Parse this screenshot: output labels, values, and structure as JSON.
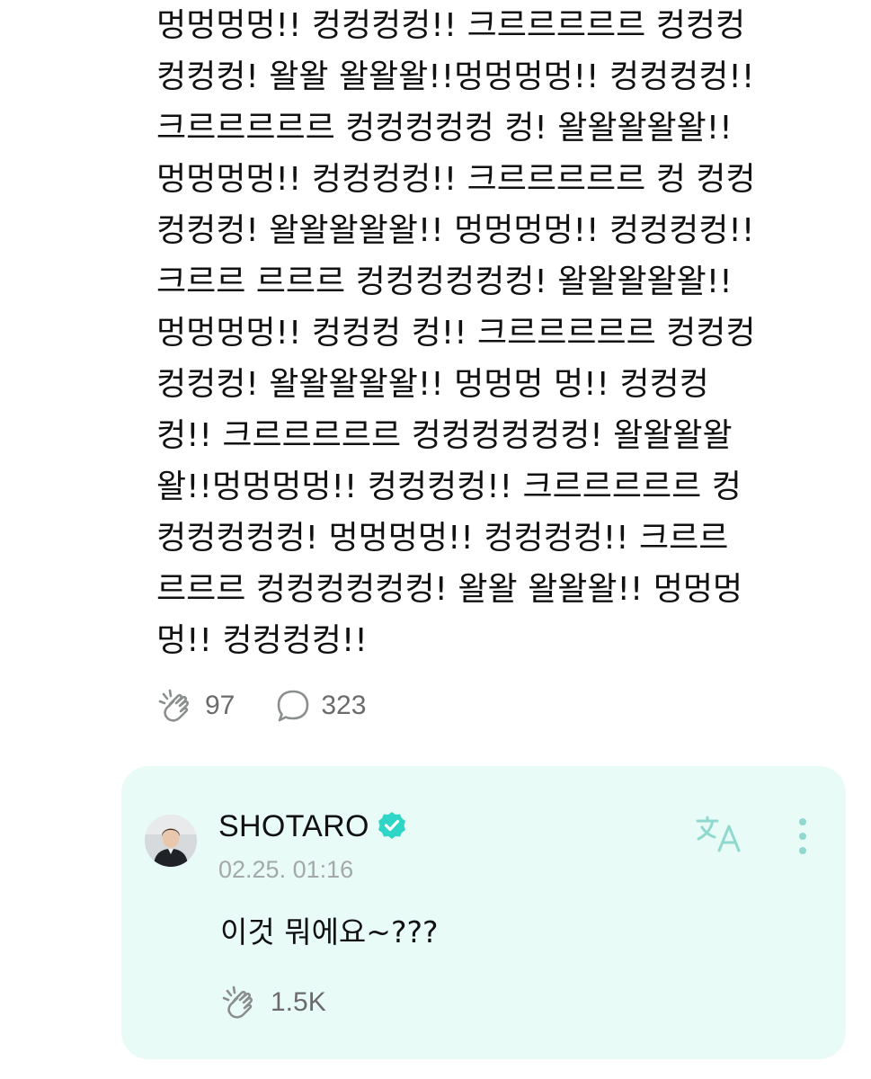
{
  "post": {
    "lines": [
      "멍멍멍멍!! 컹컹컹컹!! 크르르르르르 컹컹컹",
      "컹컹컹! 왈왈 왈왈왈!!멍멍멍멍!! 컹컹컹컹!!",
      "크르르르르르 컹컹컹컹컹 컹! 왈왈왈왈왈!!",
      "멍멍멍멍!! 컹컹컹컹!! 크르르르르르 컹 컹컹",
      "컹컹컹! 왈왈왈왈왈!! 멍멍멍멍!! 컹컹컹컹!!",
      "크르르 르르르 컹컹컹컹컹컹! 왈왈왈왈왈!!",
      "멍멍멍멍!! 컹컹컹 컹!! 크르르르르르 컹컹컹",
      "컹컹컹! 왈왈왈왈왈!! 멍멍멍 멍!! 컹컹컹",
      "컹!! 크르르르르르 컹컹컹컹컹컹! 왈왈왈왈",
      "왈!!멍멍멍멍!! 컹컹컹컹!! 크르르르르르 컹",
      "컹컹컹컹컹! 멍멍멍멍!! 컹컹컹컹!! 크르르",
      "르르르 컹컹컹컹컹컹! 왈왈 왈왈왈!! 멍멍멍",
      "멍!! 컹컹컹컹!!"
    ],
    "like_count": "97",
    "comment_count": "323",
    "icons": {
      "like": "clap-hand-icon",
      "comment": "speech-bubble-icon"
    }
  },
  "reply": {
    "author": "SHOTARO",
    "timestamp": "02.25. 01:16",
    "text": "이것 뭐에요~???",
    "like_count": "1.5K",
    "icons": {
      "verified": "verified-badge-icon",
      "translate": "translate-icon",
      "more": "more-vertical-icon",
      "like": "clap-hand-icon"
    }
  },
  "colors": {
    "card_background": "#e9fbf7",
    "verified_badge": "#2fd5c6",
    "icon_gray": "#8a8f8e",
    "count_gray": "#6b6b6b",
    "timestamp_gray": "#a3a9a7"
  }
}
